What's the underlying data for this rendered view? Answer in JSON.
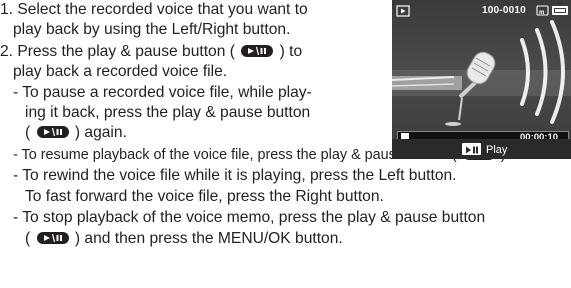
{
  "steps": [
    {
      "line1": "1. Select the recorded voice that you want to",
      "line2": "play back by using the Left/Right button."
    },
    {
      "line1_a": "2. Press the play & pause button (",
      "line1_b": ") to",
      "line2": "play back a recorded voice file."
    }
  ],
  "notes": [
    {
      "a": "- To pause a recorded voice file, while play-",
      "b": "ing it back, press the play & pause button",
      "c_open": "(",
      "c_close": ") again."
    },
    {
      "a": "- To resume playback of the voice file, press the play & pause button (",
      "a_close": ")."
    },
    {
      "a": "- To rewind the voice file while it is playing, press the Left button.",
      "b": "To fast forward the voice file, press the Right button."
    },
    {
      "a": "- To stop playback of the voice memo, press the play & pause button",
      "b_open": "(",
      "b_close": ") and then press the MENU/OK button."
    }
  ],
  "screen": {
    "file_number": "100-0010",
    "elapsed_time": "00:00:10",
    "play_label": "Play",
    "progress_fraction": 0.04,
    "icons": [
      "playback-mode-icon",
      "protect-icon",
      "battery-icon",
      "microphone-icon",
      "sound-wave-icon",
      "play-pause-icon"
    ]
  },
  "colors": {
    "text": "#231f20",
    "screen_bg": "#3e3e3e",
    "screen_text": "#ffffff"
  }
}
